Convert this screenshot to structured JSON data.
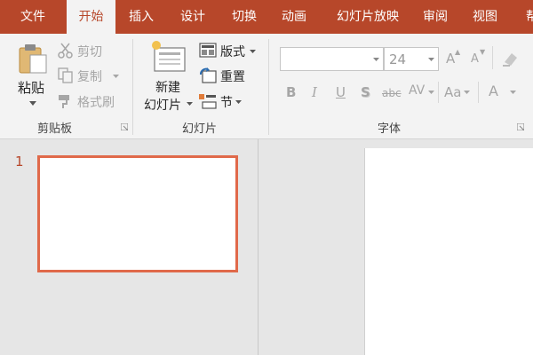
{
  "tabs": [
    {
      "label": "文件",
      "active": false
    },
    {
      "label": "开始",
      "active": true
    },
    {
      "label": "插入",
      "active": false
    },
    {
      "label": "设计",
      "active": false
    },
    {
      "label": "切换",
      "active": false
    },
    {
      "label": "动画",
      "active": false
    },
    {
      "label": "幻灯片放映",
      "active": false
    },
    {
      "label": "审阅",
      "active": false
    },
    {
      "label": "视图",
      "active": false
    },
    {
      "label": "帮",
      "active": false
    }
  ],
  "clipboard": {
    "paste_label": "粘贴",
    "cut_label": "剪切",
    "copy_label": "复制",
    "format_painter_label": "格式刷",
    "group_label": "剪贴板"
  },
  "slides": {
    "new_slide_line1": "新建",
    "new_slide_line2": "幻灯片",
    "layout_label": "版式",
    "reset_label": "重置",
    "section_label": "节",
    "group_label": "幻灯片"
  },
  "font": {
    "font_name": "",
    "font_size": "24",
    "bold": "B",
    "italic": "I",
    "underline": "U",
    "shadow": "S",
    "strikethrough": "abc",
    "spacing": "AV",
    "change_case": "Aa",
    "font_color": "A",
    "grow": "A",
    "shrink": "A",
    "group_label": "字体"
  },
  "thumbnails": [
    {
      "number": "1"
    }
  ],
  "colors": {
    "accent": "#b7472a",
    "selection": "#e0694a"
  }
}
